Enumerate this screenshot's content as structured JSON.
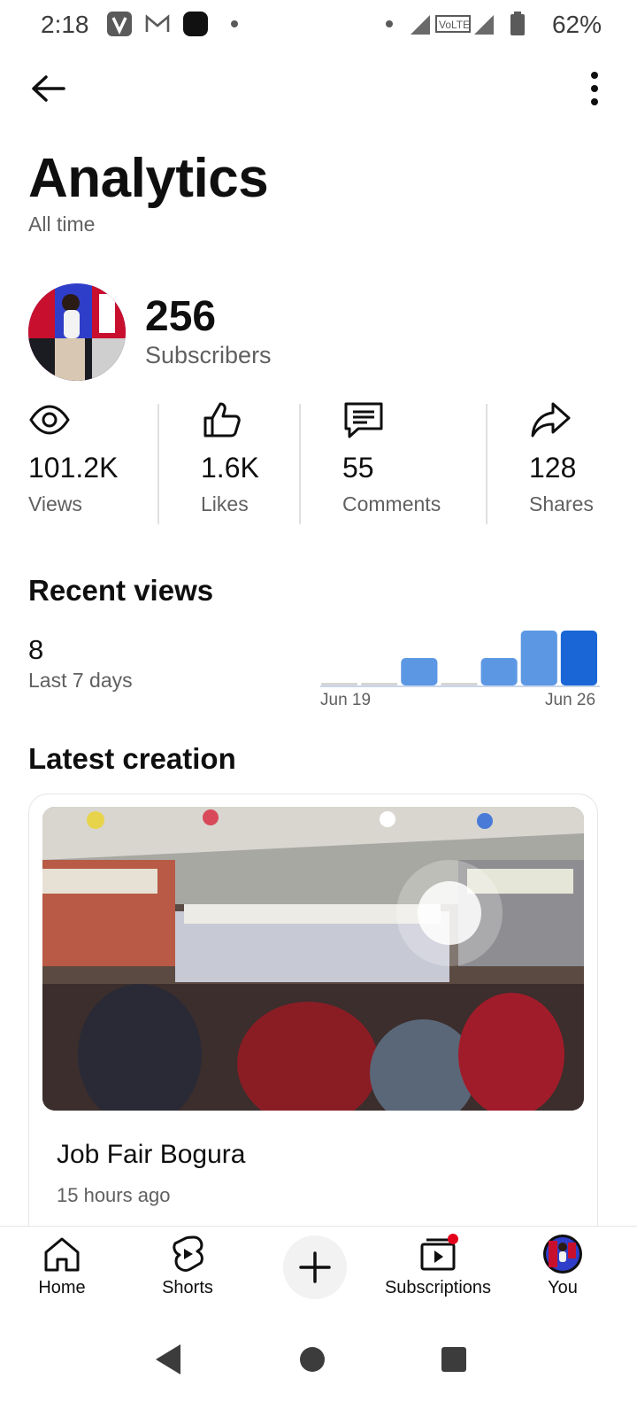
{
  "status_bar": {
    "time": "2:18",
    "battery": "62%"
  },
  "header": {
    "title": "Analytics",
    "subtitle": "All time"
  },
  "channel": {
    "subscriber_count": "256",
    "subscriber_label": "Subscribers"
  },
  "stats": [
    {
      "value": "101.2K",
      "label": "Views",
      "icon": "eye-icon"
    },
    {
      "value": "1.6K",
      "label": "Likes",
      "icon": "thumbs-up-icon"
    },
    {
      "value": "55",
      "label": "Comments",
      "icon": "comment-icon"
    },
    {
      "value": "128",
      "label": "Shares",
      "icon": "share-icon"
    }
  ],
  "recent_views": {
    "title": "Recent views",
    "count": "8",
    "period": "Last 7 days",
    "chart_data": {
      "type": "bar",
      "categories": [
        "Jun 19",
        "",
        "",
        "",
        "",
        "",
        "Jun 26"
      ],
      "values": [
        0,
        0,
        1,
        0,
        1,
        2,
        2
      ],
      "color": "#5c97e4",
      "highlight_color": "#1a66d6"
    },
    "start_label": "Jun 19",
    "end_label": "Jun 26"
  },
  "latest": {
    "title": "Latest creation",
    "video_title": "Job Fair Bogura",
    "video_time": "15 hours ago"
  },
  "nav": {
    "home": "Home",
    "shorts": "Shorts",
    "subscriptions": "Subscriptions",
    "you": "You"
  },
  "colors": {
    "accent_blue": "#1a66d6",
    "notification_dot": "#e3001b"
  }
}
